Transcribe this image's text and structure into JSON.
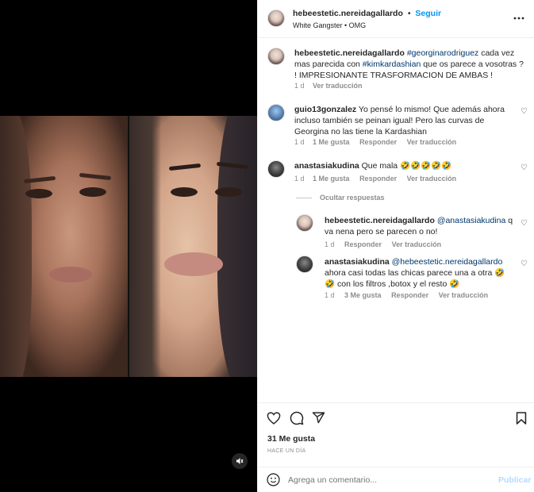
{
  "post": {
    "username": "hebeestetic.nereidagallardo",
    "follow_label": "Seguir",
    "separator": "•",
    "music": "White Gangster • OMG"
  },
  "caption": {
    "username": "hebeestetic.nereidagallardo",
    "hashtag1": "#georginarodriguez",
    "text1": " cada vez mas parecida con ",
    "hashtag2": "#kimkardashian",
    "text2": " que os parece a vosotras ? ! IMPRESIONANTE TRASFORMACION DE AMBAS !",
    "time": "1 d",
    "translate": "Ver traducción"
  },
  "comments": [
    {
      "username": "guio13gonzalez",
      "text": "Yo pensé lo mismo! Que además ahora incluso también se peinan igual! Pero las curvas de Georgina no las tiene la Kardashian",
      "time": "1 d",
      "likes": "1 Me gusta",
      "reply": "Responder",
      "translate": "Ver traducción"
    },
    {
      "username": "anastasiakudina",
      "text": "Que mala 🤣🤣🤣🤣🤣",
      "time": "1 d",
      "likes": "1 Me gusta",
      "reply": "Responder",
      "translate": "Ver traducción"
    }
  ],
  "hide_replies": "Ocultar respuestas",
  "replies": [
    {
      "username": "hebeestetic.nereidagallardo",
      "mention": "@anastasiakudina",
      "text": " q va nena pero se parecen o no!",
      "time": "1 d",
      "reply": "Responder",
      "translate": "Ver traducción"
    },
    {
      "username": "anastasiakudina",
      "mention": "@hebeestetic.nereidagallardo",
      "text": " ahora casi todas las chicas parece una a otra 🤣🤣 con los filtros ,botox y el resto 🤣",
      "time": "1 d",
      "likes": "3 Me gusta",
      "reply": "Responder",
      "translate": "Ver traducción"
    }
  ],
  "likes_count": "31 Me gusta",
  "post_time": "HACE UN DÍA",
  "comment_box": {
    "placeholder": "Agrega un comentario...",
    "publish": "Publicar"
  },
  "icons": {
    "more": "more-options-icon",
    "like": "heart-icon",
    "comment": "comment-icon",
    "share": "share-icon",
    "save": "bookmark-icon",
    "emoji": "emoji-icon",
    "audio": "audio-muted-icon"
  },
  "colors": {
    "link": "#00376b",
    "follow": "#0095f6",
    "muted": "#8e8e8e"
  }
}
